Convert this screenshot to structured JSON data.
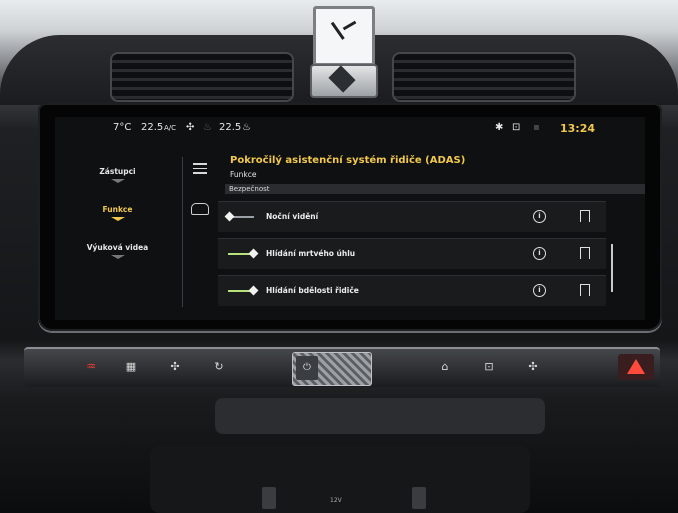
{
  "status_bar": {
    "outside_temp": "7°C",
    "left_temp": "22.5",
    "ac_label": "A/C",
    "right_temp": "22.5",
    "time": "13:24",
    "icons": [
      "fan-icon",
      "seat-heat-icon",
      "bluetooth-icon",
      "car-connect-icon"
    ]
  },
  "sidebar": {
    "items": [
      {
        "label": "Zástupci",
        "active": false
      },
      {
        "label": "Funkce",
        "active": true
      },
      {
        "label": "Výuková videa",
        "active": false
      }
    ]
  },
  "page": {
    "title": "Pokročilý asistenční systém řidiče (ADAS)",
    "subtitle": "Funkce",
    "section": "Bezpečnost"
  },
  "features": [
    {
      "label": "Noční vidění",
      "enabled": false
    },
    {
      "label": "Hlídání mrtvého úhlu",
      "enabled": true
    },
    {
      "label": "Hlídání bdělosti řidiče",
      "enabled": true
    }
  ],
  "colors": {
    "accent": "#f2c94c",
    "toggle_on": "#b7e17a",
    "hazard": "#ff4a3c"
  },
  "console": {
    "usb_label": "12V"
  }
}
